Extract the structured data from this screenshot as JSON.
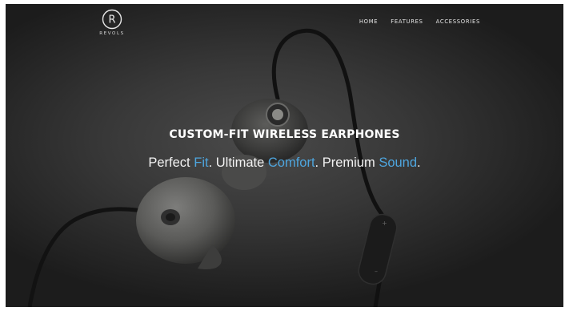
{
  "brand": {
    "name": "REVOLS",
    "logo_letter": "R"
  },
  "nav": {
    "items": [
      "HOME",
      "FEATURES",
      "ACCESSORIES"
    ]
  },
  "hero": {
    "headline": "CUSTOM-FIT WIRELESS EARPHONES",
    "tagline": [
      {
        "text": "Perfect ",
        "accent": false
      },
      {
        "text": "Fit",
        "accent": true
      },
      {
        "text": ". Ultimate ",
        "accent": false
      },
      {
        "text": "Comfort",
        "accent": true
      },
      {
        "text": ". Premium ",
        "accent": false
      },
      {
        "text": "Sound",
        "accent": true
      },
      {
        "text": ".",
        "accent": false
      }
    ]
  },
  "colors": {
    "accent": "#4ea6df",
    "background": "#2e2e2e",
    "text": "#ffffff"
  },
  "icons": {
    "logo": "revols-logo-icon"
  }
}
